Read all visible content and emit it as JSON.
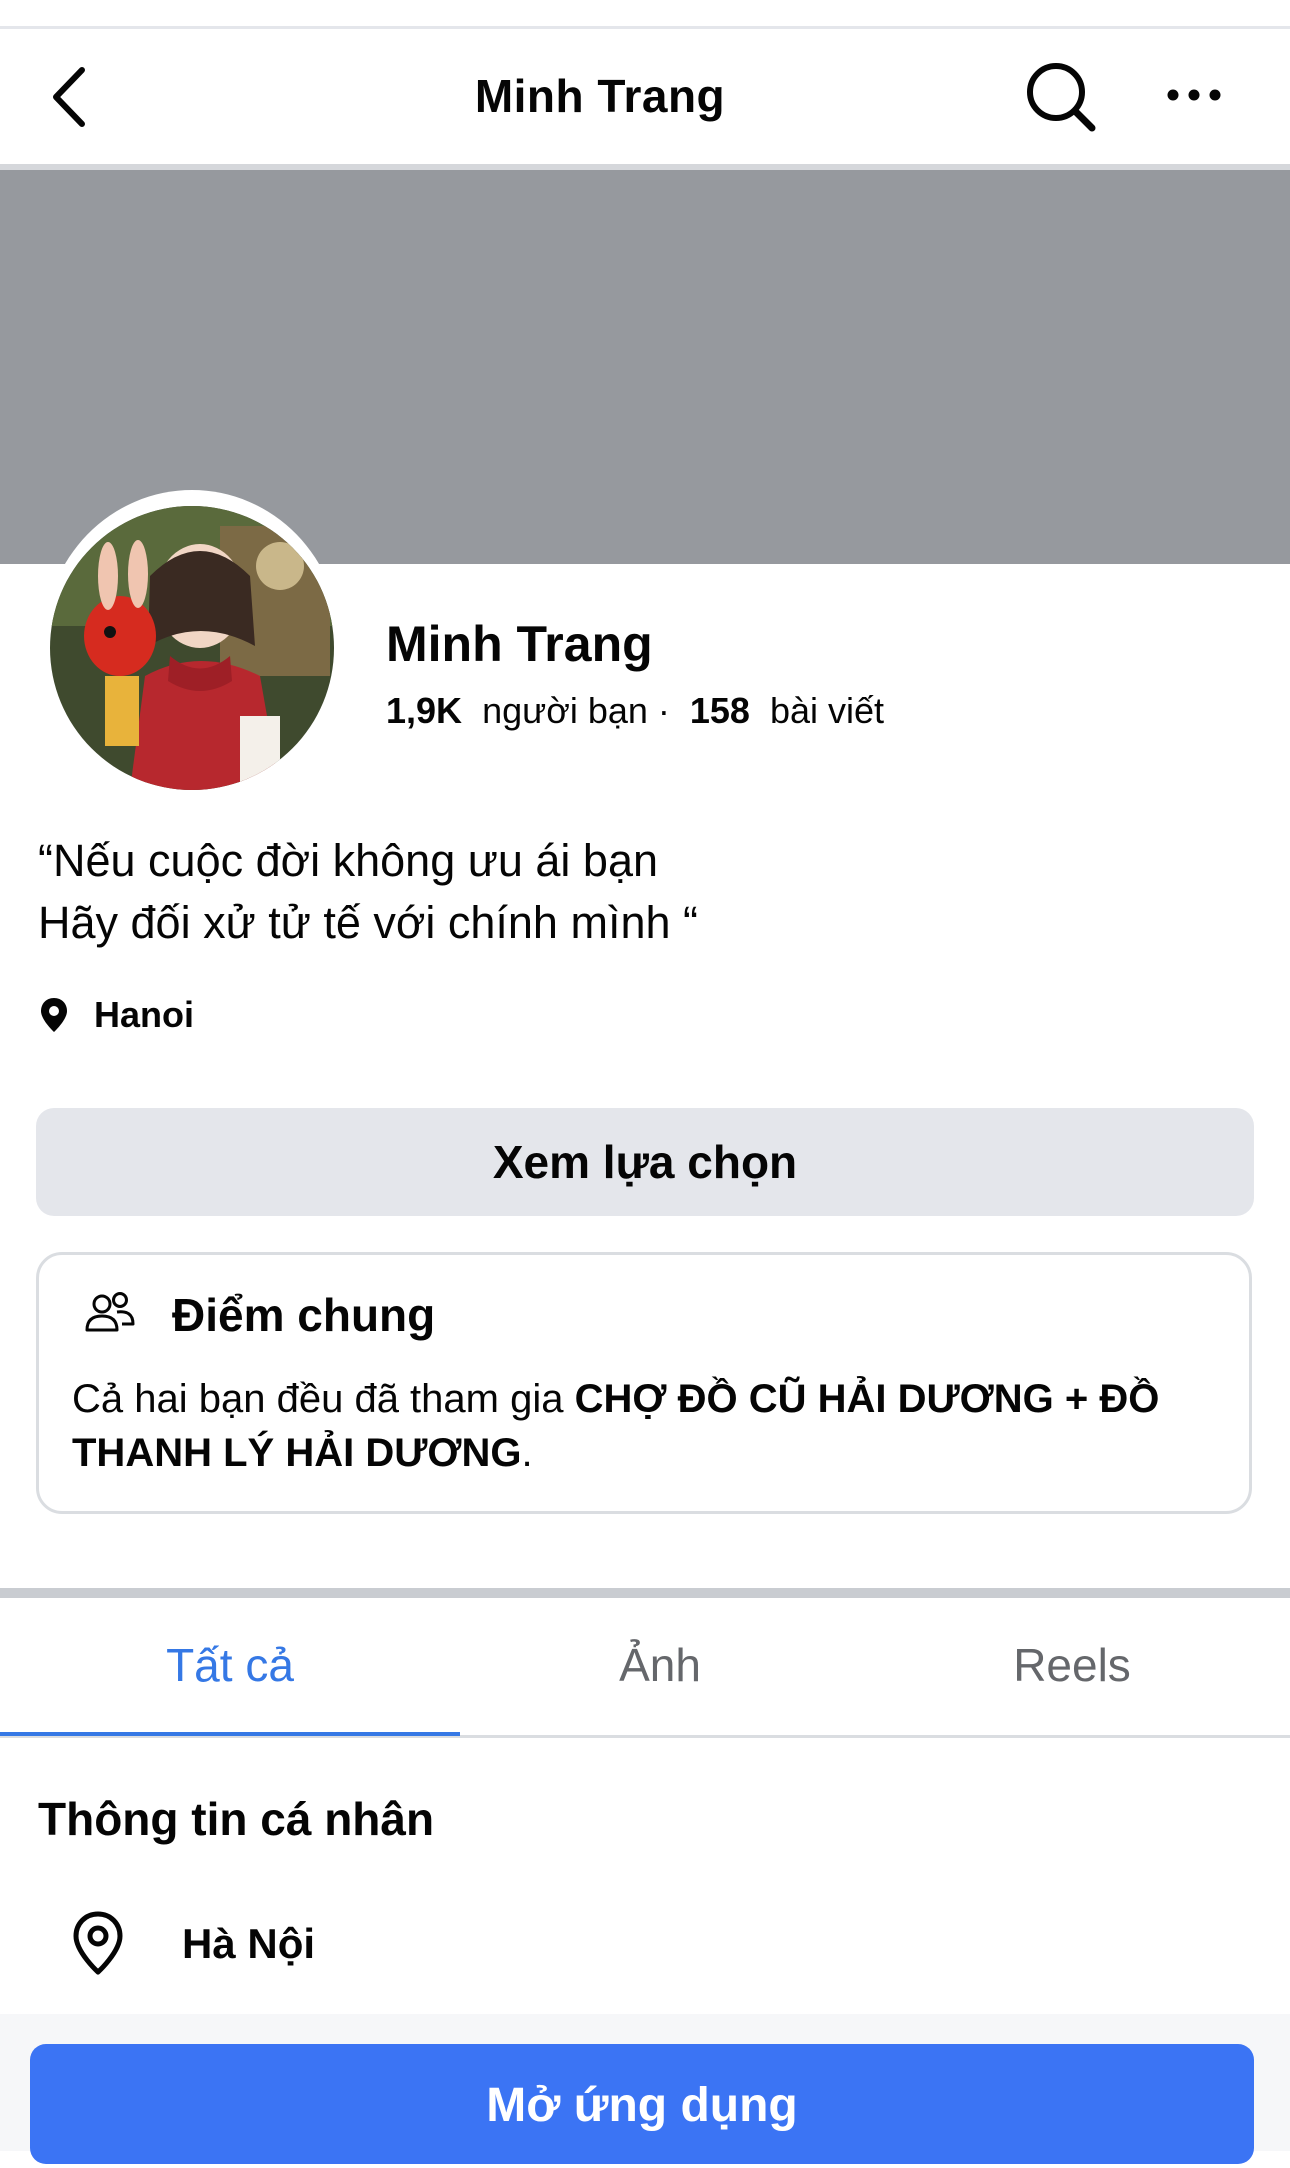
{
  "header": {
    "title": "Minh Trang",
    "back_icon": "chevron-left-icon",
    "search_icon": "search-icon",
    "more_icon": "more-horizontal-icon"
  },
  "profile": {
    "name": "Minh Trang",
    "friends_count": "1,9K",
    "friends_label": "người bạn ·",
    "posts_count": "158",
    "posts_label": "bài viết",
    "bio_line1": "“Nếu cuộc đời không ưu ái bạn",
    "bio_line2": "Hãy đối xử tử tế với chính mình “",
    "location": "Hanoi"
  },
  "actions": {
    "options_label": "Xem lựa chọn"
  },
  "common": {
    "title": "Điểm chung",
    "text_prefix": "Cả hai bạn đều đã tham gia ",
    "group_name": "CHỢ ĐỒ CŨ HẢI DƯƠNG + ĐỒ THANH LÝ HẢI DƯƠNG",
    "text_suffix": "."
  },
  "tabs": [
    {
      "label": "Tất cả",
      "active": true
    },
    {
      "label": "Ảnh",
      "active": false
    },
    {
      "label": "Reels",
      "active": false
    }
  ],
  "about": {
    "title": "Thông tin cá nhân",
    "city": "Hà Nội"
  },
  "footer": {
    "open_app_label": "Mở ứng dụng"
  },
  "colors": {
    "accent": "#3578e5",
    "cover": "#96999e",
    "button_gray": "#e4e6eb",
    "primary_button": "#3b74f4"
  }
}
